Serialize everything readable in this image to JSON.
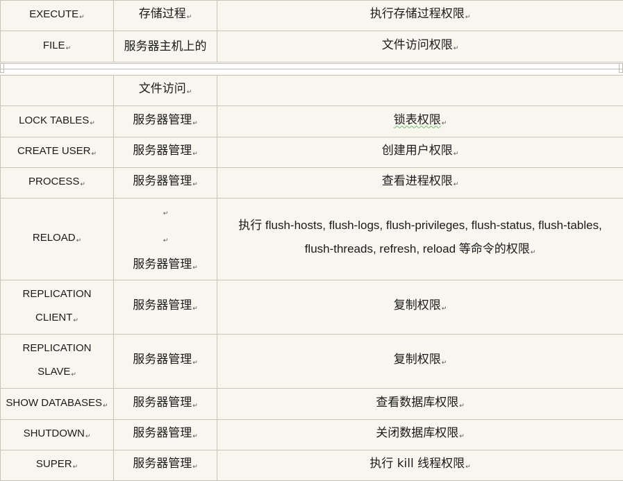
{
  "rows_top": [
    {
      "privilege": "EXECUTE",
      "context": "存储过程",
      "description": "执行存储过程权限"
    },
    {
      "privilege": "FILE",
      "context": "服务器主机上的",
      "description": "文件访问权限"
    }
  ],
  "rows_bottom": [
    {
      "privilege": "",
      "context": "文件访问",
      "description": ""
    },
    {
      "privilege": "LOCK TABLES",
      "context": "服务器管理",
      "description": "锁表权限"
    },
    {
      "privilege": "CREATE USER",
      "context": "服务器管理",
      "description": "创建用户权限"
    },
    {
      "privilege": "PROCESS",
      "context": "服务器管理",
      "description": "查看进程权限"
    },
    {
      "privilege": "RELOAD",
      "context": "服务器管理",
      "description_line1": "执行 flush-hosts, flush-logs, flush-privileges, flush-status, flush-tables,",
      "description_line2": "flush-threads, refresh, reload 等命令的权限"
    },
    {
      "privilege_line1": "REPLICATION",
      "privilege_line2": "CLIENT",
      "context": "服务器管理",
      "description": "复制权限"
    },
    {
      "privilege_line1": "REPLICATION",
      "privilege_line2": "SLAVE",
      "context": "服务器管理",
      "description": "复制权限"
    },
    {
      "privilege": "SHOW DATABASES",
      "context": "服务器管理",
      "description": "查看数据库权限"
    },
    {
      "privilege": "SHUTDOWN",
      "context": "服务器管理",
      "description": "关闭数据库权限"
    },
    {
      "privilege": "SUPER",
      "context": "服务器管理",
      "description": "执行 kill 线程权限"
    }
  ],
  "paragraph_mark": "↵",
  "colors": {
    "cell_background": "#f8f6ef",
    "border": "#c8c4b8",
    "spellcheck_underline": "#6abf6a"
  }
}
